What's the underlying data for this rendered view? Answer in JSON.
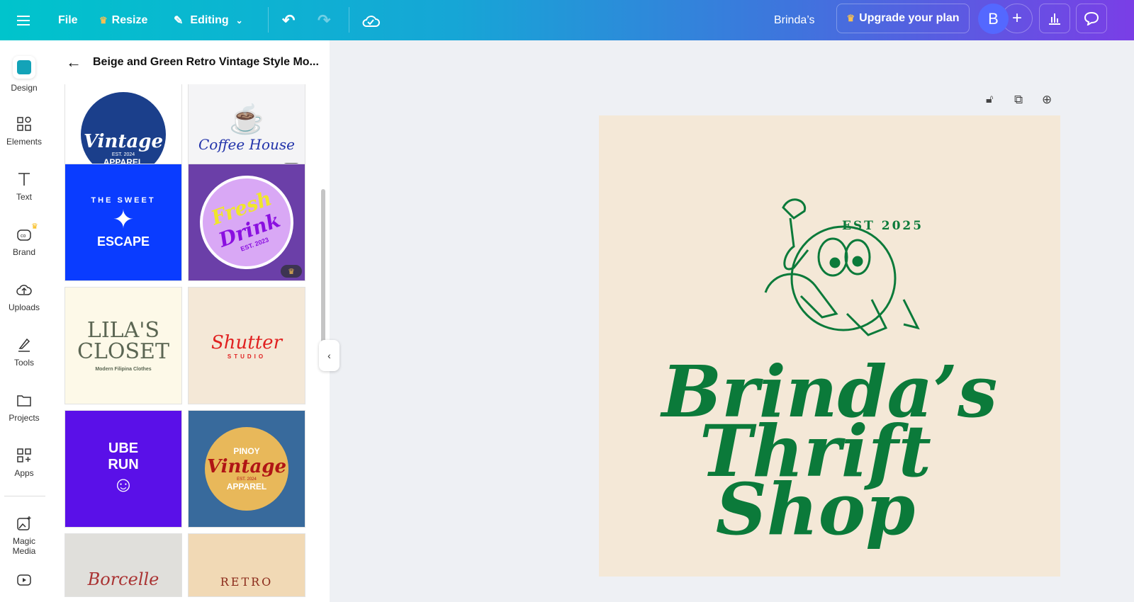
{
  "topbar": {
    "file": "File",
    "resize": "Resize",
    "editing": "Editing",
    "design_name": "Brinda’s",
    "upgrade": "Upgrade your plan",
    "avatar": "B"
  },
  "rail": [
    {
      "label": "Design"
    },
    {
      "label": "Elements"
    },
    {
      "label": "Text"
    },
    {
      "label": "Brand"
    },
    {
      "label": "Uploads"
    },
    {
      "label": "Tools"
    },
    {
      "label": "Projects"
    },
    {
      "label": "Apps"
    },
    {
      "label": "Magic Media"
    }
  ],
  "panel": {
    "title": "Beige and Green Retro Vintage Style Mo...",
    "templates": [
      {
        "t1": "Vintage",
        "t2": "EST. 2024",
        "t3": "APPAREL"
      },
      {
        "t1": "Coffee House"
      },
      {
        "t1": "THE SWEET",
        "t2": "ESCAPE"
      },
      {
        "t1": "Fresh",
        "t2": "Drink",
        "t3": "EST. 2023"
      },
      {
        "t1": "LILA'S",
        "t2": "CLOSET",
        "t3": "Modern Filipina Clothes"
      },
      {
        "t1": "Shutter",
        "t2": "STUDIO"
      },
      {
        "t1": "UBE",
        "t2": "RUN"
      },
      {
        "t1": "PINOY",
        "t2": "Vintage",
        "t3": "EST. 2024",
        "t4": "APPAREL"
      },
      {
        "t1": "Borcelle"
      },
      {
        "t1": "RETRO"
      }
    ]
  },
  "canvas": {
    "est": "EST 2025",
    "line1": "Brinda’s",
    "line2": "Thrift",
    "line3": "Shop",
    "bg": "#f4e8d7",
    "accent": "#0b7a3a"
  }
}
